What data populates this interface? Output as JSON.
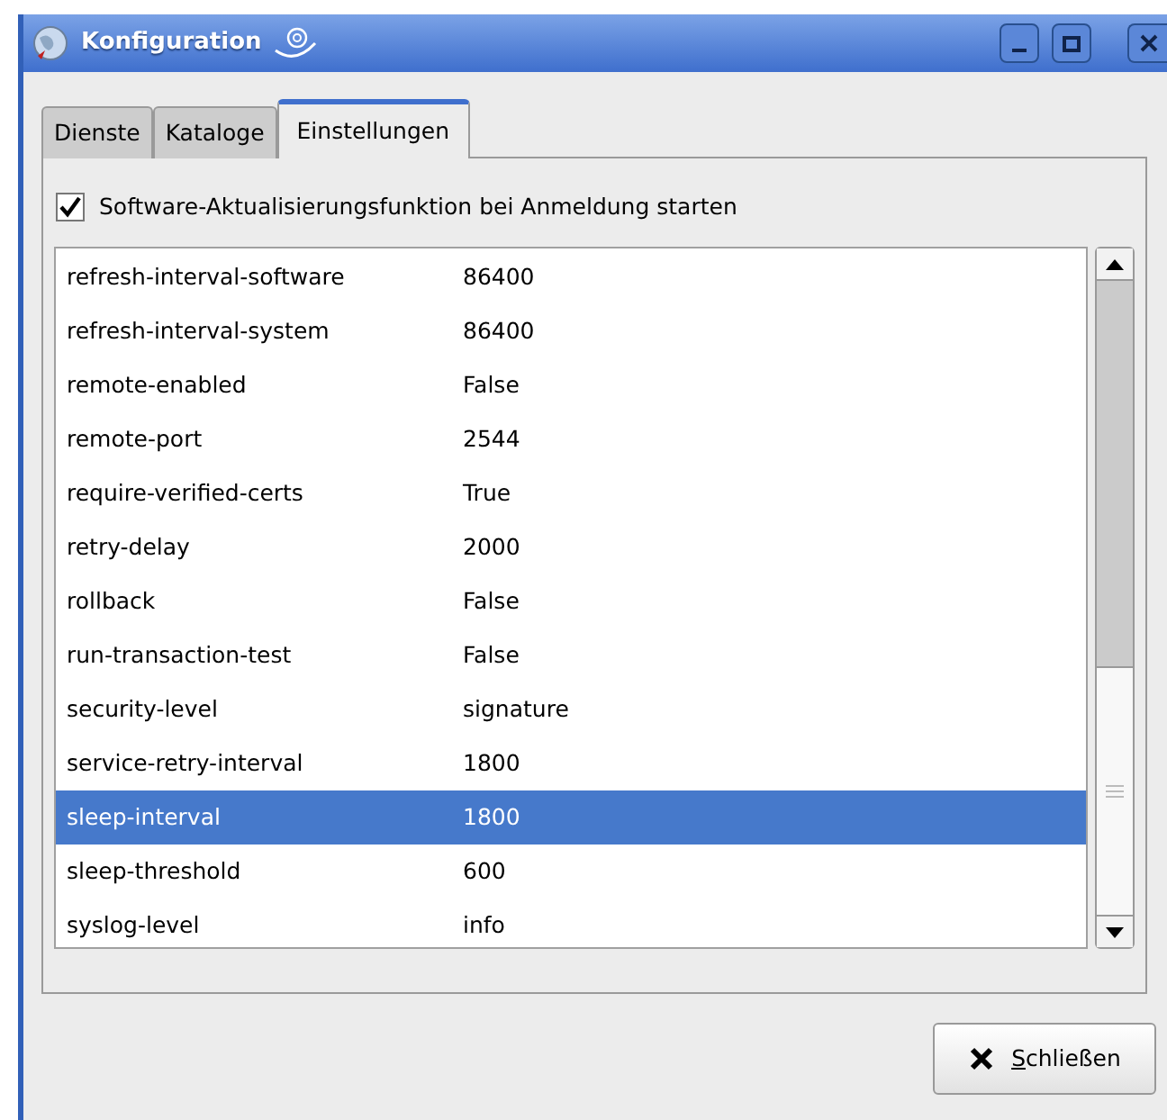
{
  "window": {
    "title": "Konfiguration"
  },
  "tabs": [
    {
      "label": "Dienste",
      "selected": false
    },
    {
      "label": "Kataloge",
      "selected": false
    },
    {
      "label": "Einstellungen",
      "selected": true
    }
  ],
  "checkbox": {
    "label": "Software-Aktualisierungsfunktion bei Anmeldung starten",
    "checked": true
  },
  "settings": [
    {
      "name": "refresh-interval-software",
      "value": "86400",
      "selected": false
    },
    {
      "name": "refresh-interval-system",
      "value": "86400",
      "selected": false
    },
    {
      "name": "remote-enabled",
      "value": "False",
      "selected": false
    },
    {
      "name": "remote-port",
      "value": "2544",
      "selected": false
    },
    {
      "name": "require-verified-certs",
      "value": "True",
      "selected": false
    },
    {
      "name": "retry-delay",
      "value": "2000",
      "selected": false
    },
    {
      "name": "rollback",
      "value": "False",
      "selected": false
    },
    {
      "name": "run-transaction-test",
      "value": "False",
      "selected": false
    },
    {
      "name": "security-level",
      "value": "signature",
      "selected": false
    },
    {
      "name": "service-retry-interval",
      "value": "1800",
      "selected": false
    },
    {
      "name": "sleep-interval",
      "value": "1800",
      "selected": true
    },
    {
      "name": "sleep-threshold",
      "value": "600",
      "selected": false
    },
    {
      "name": "syslog-level",
      "value": "info",
      "selected": false
    }
  ],
  "close_button": {
    "label": "Schließen"
  }
}
